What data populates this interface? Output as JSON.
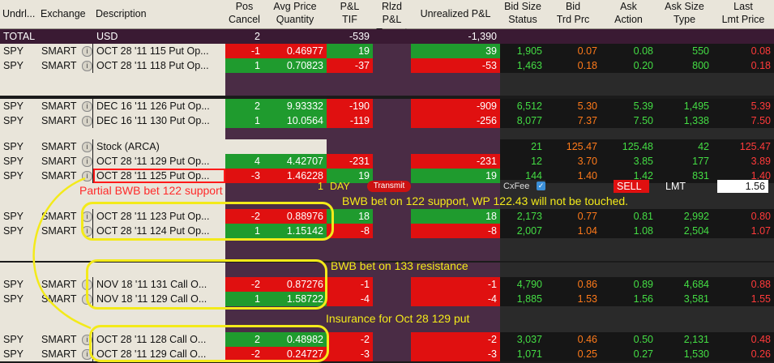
{
  "headers": [
    {
      "l1": "Undrl...",
      "l2": ""
    },
    {
      "l1": "Exchange",
      "l2": ""
    },
    {
      "l1": "Description",
      "l2": ""
    },
    {
      "l1": "Pos",
      "l2": "Cancel"
    },
    {
      "l1": "Avg Price",
      "l2": "Quantity"
    },
    {
      "l1": "P&L",
      "l2": "TIF"
    },
    {
      "l1": "Rlzd P&L",
      "l2": "Trnsmt"
    },
    {
      "l1": "Unrealized P&L",
      "l2": ""
    },
    {
      "l1": "Bid Size",
      "l2": "Status"
    },
    {
      "l1": "Bid",
      "l2": "Trd Prc"
    },
    {
      "l1": "Ask",
      "l2": "Action"
    },
    {
      "l1": "Ask Size",
      "l2": "Type"
    },
    {
      "l1": "Last",
      "l2": "Lmt Price"
    }
  ],
  "total": {
    "und": "TOTAL",
    "desc": "USD",
    "pos": "2",
    "pnl": "-539",
    "unreal": "-1,390"
  },
  "positions": [
    {
      "und": "SPY",
      "exch": "SMART",
      "desc": "OCT 28 '11 115 Put Op...",
      "pos": "-1",
      "avg": "0.46977",
      "pnl": "19",
      "unreal": "39",
      "bidsize": "1,905",
      "bid": "0.07",
      "ask": "0.08",
      "asksize": "550",
      "last": "0.08"
    },
    {
      "und": "SPY",
      "exch": "SMART",
      "desc": "OCT 28 '11 118 Put Op...",
      "pos": "1",
      "avg": "0.70823",
      "pnl": "-37",
      "unreal": "-53",
      "bidsize": "1,463",
      "bid": "0.18",
      "ask": "0.20",
      "asksize": "800",
      "last": "0.18"
    },
    {
      "und": "SPY",
      "exch": "SMART",
      "desc": "DEC 16 '11 126 Put Op...",
      "pos": "2",
      "avg": "9.93332",
      "pnl": "-190",
      "unreal": "-909",
      "bidsize": "6,512",
      "bid": "5.30",
      "ask": "5.39",
      "asksize": "1,495",
      "last": "5.39"
    },
    {
      "und": "SPY",
      "exch": "SMART",
      "desc": "DEC 16 '11 130 Put Op...",
      "pos": "1",
      "avg": "10.0564",
      "pnl": "-119",
      "unreal": "-256",
      "bidsize": "8,077",
      "bid": "7.37",
      "ask": "7.50",
      "asksize": "1,338",
      "last": "7.50"
    },
    {
      "und": "SPY",
      "exch": "SMART",
      "desc": "Stock (ARCA)",
      "pos": "",
      "avg": "",
      "pnl": "",
      "unreal": "",
      "bidsize": "21",
      "bid": "125.47",
      "ask": "125.48",
      "asksize": "42",
      "last": "125.47"
    },
    {
      "und": "SPY",
      "exch": "SMART",
      "desc": "OCT 28 '11 129 Put Op...",
      "pos": "4",
      "avg": "4.42707",
      "pnl": "-231",
      "unreal": "-231",
      "bidsize": "12",
      "bid": "3.70",
      "ask": "3.85",
      "asksize": "177",
      "last": "3.89"
    },
    {
      "und": "SPY",
      "exch": "SMART",
      "desc": "OCT 28 '11 125 Put Op...",
      "pos": "-3",
      "avg": "1.46228",
      "pnl": "19",
      "unreal": "19",
      "bidsize": "144",
      "bid": "1.40",
      "ask": "1.42",
      "asksize": "831",
      "last": "1.40"
    },
    {
      "und": "SPY",
      "exch": "SMART",
      "desc": "OCT 28 '11 123 Put Op...",
      "pos": "-2",
      "avg": "0.88976",
      "pnl": "18",
      "unreal": "18",
      "bidsize": "2,173",
      "bid": "0.77",
      "ask": "0.81",
      "asksize": "2,992",
      "last": "0.80"
    },
    {
      "und": "SPY",
      "exch": "SMART",
      "desc": "OCT 28 '11 124 Put Op...",
      "pos": "1",
      "avg": "1.15142",
      "pnl": "-8",
      "unreal": "-8",
      "bidsize": "2,007",
      "bid": "1.04",
      "ask": "1.08",
      "asksize": "2,504",
      "last": "1.07"
    },
    {
      "und": "SPY",
      "exch": "SMART",
      "desc": "NOV 18 '11 131 Call O...",
      "pos": "-2",
      "avg": "0.87276",
      "pnl": "-1",
      "unreal": "-1",
      "bidsize": "4,790",
      "bid": "0.86",
      "ask": "0.89",
      "asksize": "4,684",
      "last": "0.88"
    },
    {
      "und": "SPY",
      "exch": "SMART",
      "desc": "NOV 18 '11 129 Call O...",
      "pos": "1",
      "avg": "1.58722",
      "pnl": "-4",
      "unreal": "-4",
      "bidsize": "1,885",
      "bid": "1.53",
      "ask": "1.56",
      "asksize": "3,581",
      "last": "1.55"
    },
    {
      "und": "SPY",
      "exch": "SMART",
      "desc": "OCT 28 '11 128 Call O...",
      "pos": "2",
      "avg": "0.48982",
      "pnl": "-2",
      "unreal": "-2",
      "bidsize": "3,037",
      "bid": "0.46",
      "ask": "0.50",
      "asksize": "2,131",
      "last": "0.48"
    },
    {
      "und": "SPY",
      "exch": "SMART",
      "desc": "OCT 28 '11 129 Call O...",
      "pos": "-2",
      "avg": "0.24727",
      "pnl": "-3",
      "unreal": "-3",
      "bidsize": "1,071",
      "bid": "0.25",
      "ask": "0.27",
      "asksize": "1,530",
      "last": "0.26"
    }
  ],
  "order": {
    "qty": "1",
    "tif": "DAY",
    "transmit": "Transmit",
    "status": "CxFee",
    "action": "SELL",
    "type": "LMT",
    "lmt": "1.56"
  },
  "annotations": {
    "partial": "Partial BWB bet 122 support",
    "bwb122": "BWB bet on 122 support, WP 122.43 will not be touched.",
    "bwb133": "BWB bet on 133 resistance",
    "insurance": "Insurance for Oct 28 129 put"
  },
  "colors": {
    "green": "#1f9b2e",
    "red": "#e01010",
    "tan": "#e9e5da",
    "dark": "#1b1b1b",
    "posText": "#44dd44",
    "negText": "#ff3a3a",
    "yellow": "#f3ea1a"
  }
}
